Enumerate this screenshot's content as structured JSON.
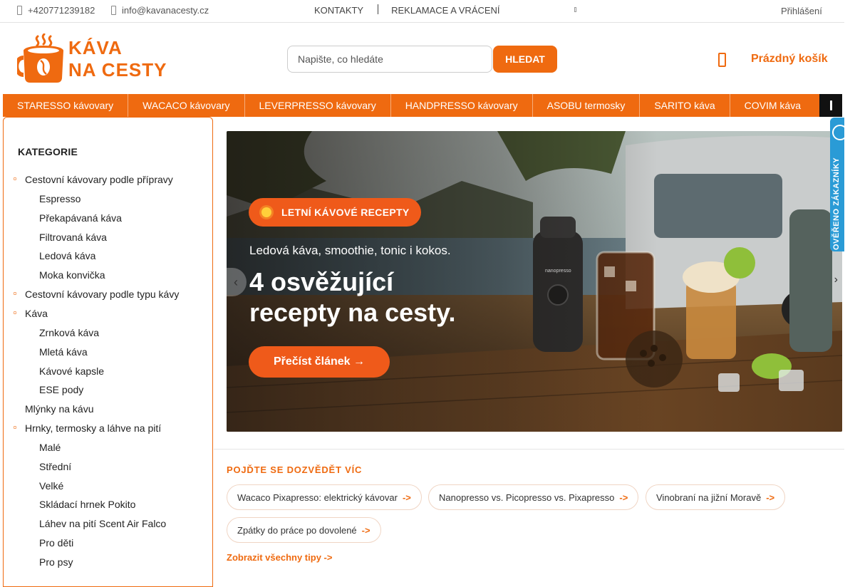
{
  "topbar": {
    "phone": "+420771239182",
    "email": "info@kavanacesty.cz",
    "contacts": "KONTAKTY",
    "returns": "REKLAMACE A VRÁCENÍ",
    "login": "Přihlášení"
  },
  "header": {
    "logo_line1": "KÁVA",
    "logo_line2": "NA CESTY",
    "search_placeholder": "Napište, co hledáte",
    "search_button": "HLEDAT",
    "cart": "Prázdný košík"
  },
  "menu": [
    "STARESSO kávovary",
    "WACACO kávovary",
    "LEVERPRESSO kávovary",
    "HANDPRESSO kávovary",
    "ASOBU termosky",
    "SARITO káva",
    "COVIM káva"
  ],
  "sidebar": {
    "title": "KATEGORIE",
    "items": [
      {
        "label": "Cestovní kávovary podle přípravy",
        "level": 1,
        "bullet": true
      },
      {
        "label": "Espresso",
        "level": 2
      },
      {
        "label": "Překapávaná káva",
        "level": 2
      },
      {
        "label": "Filtrovaná káva",
        "level": 2
      },
      {
        "label": "Ledová káva",
        "level": 2
      },
      {
        "label": "Moka konvička",
        "level": 2
      },
      {
        "label": "Cestovní kávovary podle typu kávy",
        "level": 1,
        "bullet": true
      },
      {
        "label": "Káva",
        "level": 1,
        "bullet": true
      },
      {
        "label": "Zrnková káva",
        "level": 2
      },
      {
        "label": "Mletá káva",
        "level": 2
      },
      {
        "label": "Kávové kapsle",
        "level": 2
      },
      {
        "label": "ESE pody",
        "level": 2
      },
      {
        "label": "Mlýnky na kávu",
        "level": 1,
        "bullet": false
      },
      {
        "label": "Hrnky, termosky a láhve na pití",
        "level": 1,
        "bullet": true
      },
      {
        "label": "Malé",
        "level": 2
      },
      {
        "label": "Střední",
        "level": 2
      },
      {
        "label": "Velké",
        "level": 2
      },
      {
        "label": "Skládací hrnek Pokito",
        "level": 2
      },
      {
        "label": "Láhev na pití Scent Air Falco",
        "level": 2
      },
      {
        "label": "Pro děti",
        "level": 2
      },
      {
        "label": "Pro psy",
        "level": 2
      }
    ]
  },
  "banner": {
    "badge": "LETNÍ KÁVOVÉ RECEPTY",
    "subtitle": "Ledová káva, smoothie, tonic i kokos.",
    "headline_1": "4 osvěžující",
    "headline_2": "recepty na cesty.",
    "cta": "Přečíst článek →",
    "machine_brand": "nanopresso"
  },
  "verified": "OVĚŘENO ZÁKAZNÍKY",
  "tips": {
    "title": "POJĎTE SE DOZVĚDĚT VÍC",
    "items": [
      {
        "label": "Wacaco Pixapresso: elektrický kávovar",
        "arrow": "->"
      },
      {
        "label": "Nanopresso vs. Picopresso vs. Pixapresso",
        "arrow": "->"
      },
      {
        "label": "Vinobraní na jižní Moravě",
        "arrow": "->"
      },
      {
        "label": "Zpátky do práce po dovolené",
        "arrow": "->"
      }
    ],
    "all": "Zobrazit všechny tipy ->"
  },
  "colors": {
    "accent": "#ef6a10",
    "verify": "#2a9bd6"
  }
}
